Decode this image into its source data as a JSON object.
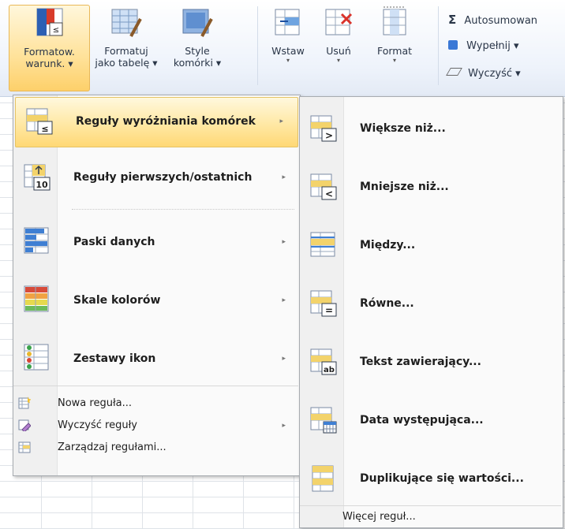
{
  "ribbon": {
    "conditional_format": {
      "line1": "Formatow.",
      "line2": "warunk. ▾"
    },
    "format_table": {
      "line1": "Formatuj",
      "line2": "jako tabelę ▾"
    },
    "cell_styles": {
      "line1": "Style",
      "line2": "komórki ▾"
    },
    "insert": {
      "line1": "Wstaw",
      "arrow": "▾"
    },
    "delete": {
      "line1": "Usuń",
      "arrow": "▾"
    },
    "format": {
      "line1": "Format",
      "arrow": "▾"
    },
    "autosum": {
      "symbol": "Σ",
      "label": "Autosumowan"
    },
    "fill": {
      "label": "Wypełnij ▾"
    },
    "clear": {
      "label": "Wyczyść ▾"
    }
  },
  "main_menu": {
    "items": [
      {
        "label": "Reguły wyróżniania komórek",
        "submenu": true,
        "highlighted": true
      },
      {
        "label": "Reguły pierwszych/ostatnich",
        "submenu": true
      },
      {
        "label": "Paski danych",
        "submenu": true
      },
      {
        "label": "Skale kolorów",
        "submenu": true
      },
      {
        "label": "Zestawy ikon",
        "submenu": true
      }
    ],
    "small_items": [
      {
        "label": "Nowa reguła..."
      },
      {
        "label": "Wyczyść reguły",
        "submenu": true
      },
      {
        "label": "Zarządzaj regułami..."
      }
    ],
    "submenu_arrow": "▸"
  },
  "sub_menu": {
    "items": [
      {
        "label": "Większe niż...",
        "glyph": ">"
      },
      {
        "label": "Mniejsze niż...",
        "glyph": "<"
      },
      {
        "label": "Między..."
      },
      {
        "label": "Równe...",
        "glyph": "="
      },
      {
        "label": "Tekst zawierający...",
        "glyph": "ab"
      },
      {
        "label": "Data występująca..."
      },
      {
        "label": "Duplikujące się wartości..."
      }
    ],
    "more_rules": "Więcej reguł..."
  },
  "colors": {
    "highlight": "#ffe29a",
    "menu_bg": "#fafafa",
    "border": "#a7abb0"
  }
}
